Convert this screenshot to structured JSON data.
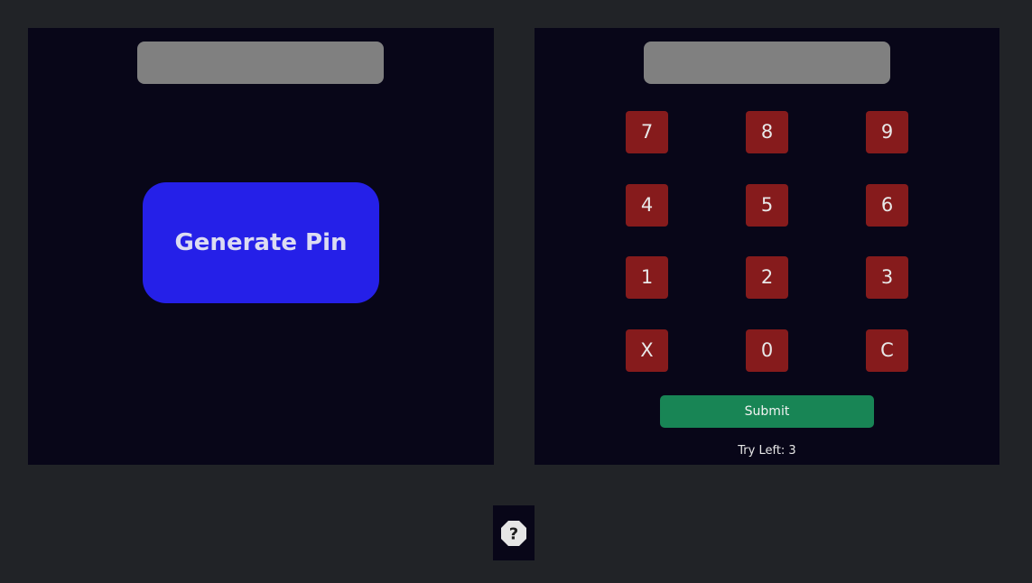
{
  "generator": {
    "display_value": "",
    "generate_label": "Generate Pin"
  },
  "keypad": {
    "display_value": "",
    "keys": [
      "7",
      "8",
      "9",
      "4",
      "5",
      "6",
      "1",
      "2",
      "3",
      "X",
      "0",
      "C"
    ],
    "submit_label": "Submit",
    "try_left_text": "Try Left: 3"
  },
  "help": {
    "icon": "question-icon",
    "glyph": "?"
  },
  "colors": {
    "background": "#212327",
    "panel": "#080618",
    "display": "#808080",
    "generate_button": "#2520e8",
    "key": "#861b1c",
    "submit": "#188555"
  }
}
